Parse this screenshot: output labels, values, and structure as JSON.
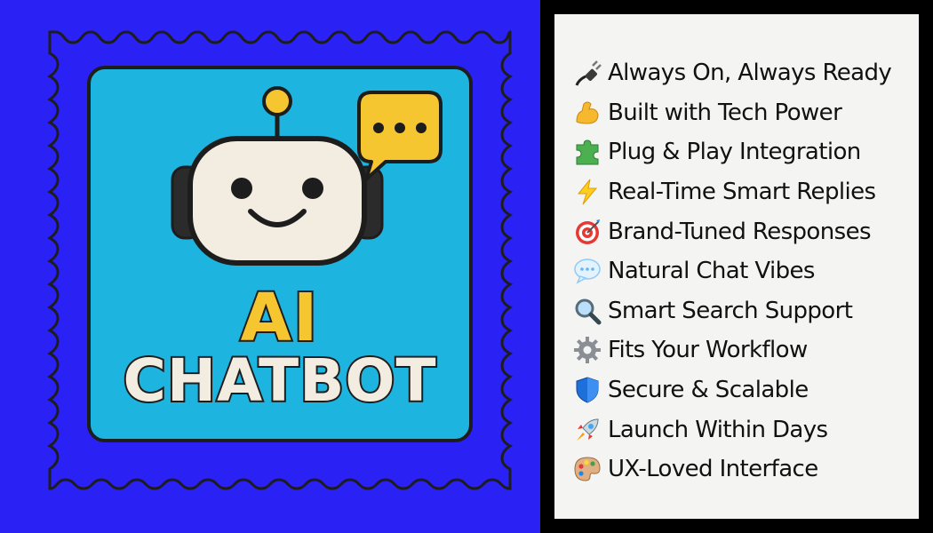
{
  "stamp": {
    "line1": "AI",
    "line2": "CHATBOT",
    "colors": {
      "background": "#2a22f4",
      "inner": "#1eb4e0",
      "accent": "#f6c631",
      "text_light": "#f2ede0",
      "outline": "#1d1d1d"
    }
  },
  "features": [
    {
      "icon": "plug-icon",
      "text": "Always On, Always Ready"
    },
    {
      "icon": "flexed-biceps-icon",
      "text": "Built with Tech Power"
    },
    {
      "icon": "puzzle-piece-icon",
      "text": "Plug & Play Integration"
    },
    {
      "icon": "lightning-icon",
      "text": "Real-Time Smart Replies"
    },
    {
      "icon": "target-icon",
      "text": "Brand-Tuned Responses"
    },
    {
      "icon": "speech-bubble-icon",
      "text": "Natural Chat Vibes"
    },
    {
      "icon": "magnifier-icon",
      "text": "Smart Search Support"
    },
    {
      "icon": "gear-icon",
      "text": "Fits Your Workflow"
    },
    {
      "icon": "shield-icon",
      "text": "Secure & Scalable"
    },
    {
      "icon": "rocket-icon",
      "text": "Launch Within Days"
    },
    {
      "icon": "palette-icon",
      "text": "UX-Loved Interface"
    }
  ]
}
